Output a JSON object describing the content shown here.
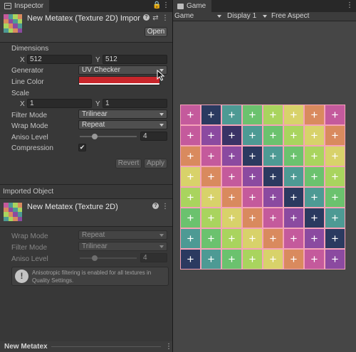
{
  "inspector": {
    "tab_label": "Inspector",
    "tab_tools": [
      "🔒",
      "⋮"
    ],
    "title": "New Metatex (Texture 2D) Impor",
    "header_icons": [
      "?",
      "⇄",
      "⋮"
    ],
    "open_label": "Open",
    "dimensions_label": "Dimensions",
    "dim_x_label": "X",
    "dim_x_value": "512",
    "dim_y_label": "Y",
    "dim_y_value": "512",
    "generator_label": "Generator",
    "generator_value": "UV Checker",
    "line_color_label": "Line Color",
    "line_color": "#c8262b",
    "scale_label": "Scale",
    "scale_x_label": "X",
    "scale_x_value": "1",
    "scale_y_label": "Y",
    "scale_y_value": "1",
    "filter_mode_label": "Filter Mode",
    "filter_mode_value": "Trilinear",
    "wrap_mode_label": "Wrap Mode",
    "wrap_mode_value": "Repeat",
    "aniso_label": "Aniso Level",
    "aniso_value": "4",
    "compression_label": "Compression",
    "compression_checked": "✔",
    "revert_label": "Revert",
    "apply_label": "Apply"
  },
  "imported": {
    "section_label": "Imported Object",
    "title": "New Metatex (Texture 2D)",
    "header_icons": [
      "?",
      "⋮"
    ],
    "wrap_mode_label": "Wrap Mode",
    "wrap_mode_value": "Repeat",
    "filter_mode_label": "Filter Mode",
    "filter_mode_value": "Trilinear",
    "aniso_label": "Aniso Level",
    "aniso_value": "4",
    "help_icon": "!",
    "help_text": "Anisotropic filtering is enabled for all textures in Quality Settings."
  },
  "bottom_bar": {
    "label": "New Metatex",
    "menu_icon": "⋮"
  },
  "game": {
    "tab_label": "Game",
    "tab_menu": "⋮",
    "view_dropdown": "Game",
    "display_dropdown": "Display 1",
    "aspect_dropdown": "Free Aspect",
    "grid_symbol": "+",
    "grid_border_color": "#f5a3b8",
    "grid_colors": [
      [
        "#c45a9c",
        "#2b3a60",
        "#4d9a94",
        "#6bc26e",
        "#a9d45e",
        "#d8d26a",
        "#d98a5e",
        "#c45a9c"
      ],
      [
        "#c45a9c",
        "#8b4aa0",
        "#3a3366",
        "#4d9a94",
        "#6bc26e",
        "#a9d45e",
        "#d8d26a",
        "#d98a5e"
      ],
      [
        "#d98a5e",
        "#c45a9c",
        "#8b4aa0",
        "#2b3a60",
        "#4d9a94",
        "#6bc26e",
        "#a9d45e",
        "#d8d26a"
      ],
      [
        "#d8d26a",
        "#d98a5e",
        "#c45a9c",
        "#8b4aa0",
        "#2b3a60",
        "#4d9a94",
        "#6bc26e",
        "#a9d45e"
      ],
      [
        "#a9d45e",
        "#d8d26a",
        "#d98a5e",
        "#c45a9c",
        "#8b4aa0",
        "#2b3a60",
        "#4d9a94",
        "#6bc26e"
      ],
      [
        "#6bc26e",
        "#a9d45e",
        "#d8d26a",
        "#d98a5e",
        "#c45a9c",
        "#8b4aa0",
        "#2b3a60",
        "#4d9a94"
      ],
      [
        "#4d9a94",
        "#6bc26e",
        "#a9d45e",
        "#d8d26a",
        "#d98a5e",
        "#c45a9c",
        "#8b4aa0",
        "#2b3a60"
      ],
      [
        "#2b3a60",
        "#4d9a94",
        "#6bc26e",
        "#a9d45e",
        "#d8d26a",
        "#d98a5e",
        "#c45a9c",
        "#8b4aa0"
      ]
    ]
  }
}
